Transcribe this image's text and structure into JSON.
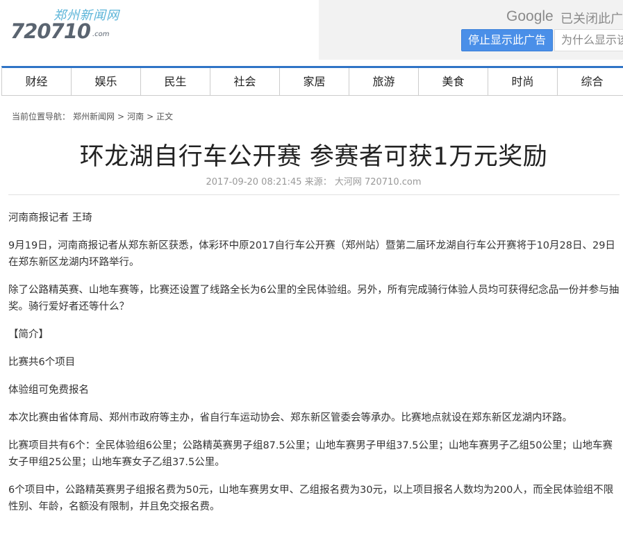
{
  "logo": {
    "site_name": "郑州新闻网",
    "number": "720710",
    "suffix": ".com"
  },
  "ad": {
    "brand": "Google",
    "closed_text": "已关闭此广告",
    "stop_button": "停止显示此广告",
    "why_button": "为什么显示该广告？"
  },
  "nav": {
    "items": [
      "财经",
      "娱乐",
      "民生",
      "社会",
      "家居",
      "旅游",
      "美食",
      "时尚",
      "综合"
    ]
  },
  "breadcrumb": {
    "prefix": "当前位置导航：",
    "home": "郑州新闻网",
    "sep1": ">",
    "section": "河南",
    "sep2": ">",
    "current": "正文"
  },
  "article": {
    "title": "环龙湖自行车公开赛 参赛者可获1万元奖励",
    "meta": "2017-09-20 08:21:45 来源： 大河网 720710.com",
    "paragraphs": [
      "河南商报记者 王琦",
      "9月19日，河南商报记者从郑东新区获悉，体彩环中原2017自行车公开赛（郑州站）暨第二届环龙湖自行车公开赛将于10月28日、29日在郑东新区龙湖内环路举行。",
      "除了公路精英赛、山地车赛等，比赛还设置了线路全长为6公里的全民体验组。另外，所有完成骑行体验人员均可获得纪念品一份并参与抽奖。骑行爱好者还等什么？",
      "【简介】",
      "比赛共6个项目",
      "体验组可免费报名",
      "本次比赛由省体育局、郑州市政府等主办，省自行车运动协会、郑东新区管委会等承办。比赛地点就设在郑东新区龙湖内环路。",
      "比赛项目共有6个：全民体验组6公里；公路精英赛男子组87.5公里；山地车赛男子甲组37.5公里；山地车赛男子乙组50公里；山地车赛女子甲组25公里；山地车赛女子乙组37.5公里。",
      "6个项目中，公路精英赛男子组报名费为50元，山地车赛男女甲、乙组报名费为30元，以上项目报名人数均为200人，而全民体验组不限性别、年龄，名额没有限制，并且免交报名费。"
    ]
  },
  "colors": {
    "nav_accent": "#2f74c6",
    "ad_button": "#4a8fe8",
    "logo_blue": "#5bb4d8"
  }
}
